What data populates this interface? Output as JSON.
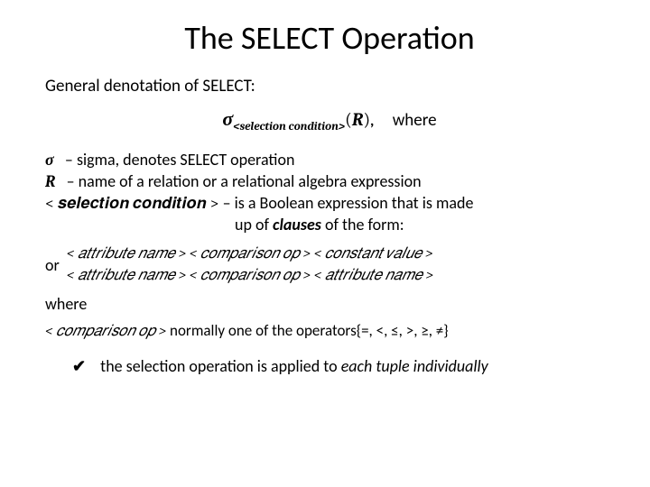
{
  "title": "The SELECT Operation",
  "subtitle": "General denotation of SELECT:",
  "formula": {
    "sigma": "σ",
    "subscript": "<selection condition>",
    "R_open": "(",
    "R": "R",
    "R_close": "),",
    "where": "where"
  },
  "defs": {
    "sigma_sym": "σ",
    "sigma_text": "– sigma, denotes SELECT operation",
    "R_sym": "R",
    "R_text": "– name of a relation or a relational algebra expression",
    "sc_sym": "< 𝒔𝒆𝒍𝒆𝒄𝒕𝒊𝒐𝒏 𝒄𝒐𝒏𝒅𝒊𝒕𝒊𝒐𝒏 >",
    "sc_text1": "– is a Boolean expression that is made",
    "sc_text2a": "up of ",
    "sc_text2b": "clauses",
    "sc_text2c": " of the form:"
  },
  "or_label": "or",
  "attr_line1": "< 𝑎𝑡𝑡𝑟𝑖𝑏𝑢𝑡𝑒 𝑛𝑎𝑚𝑒 > <  𝑐𝑜𝑚𝑝𝑎𝑟𝑖𝑠𝑜𝑛 𝑜𝑝 > < 𝑐𝑜𝑛𝑠𝑡𝑎𝑛𝑡 𝑣𝑎𝑙𝑢𝑒 >",
  "attr_line2": "< 𝑎𝑡𝑡𝑟𝑖𝑏𝑢𝑡𝑒 𝑛𝑎𝑚𝑒 > <  𝑐𝑜𝑚𝑝𝑎𝑟𝑖𝑠𝑜𝑛 𝑜𝑝 > < 𝑎𝑡𝑡𝑟𝑖𝑏𝑢𝑡𝑒 𝑛𝑎𝑚𝑒 >",
  "where_label": "where",
  "op_math": "<  𝑐𝑜𝑚𝑝𝑎𝑟𝑖𝑠𝑜𝑛 𝑜𝑝 >",
  "op_text": " normally one of the operators{=, <, ≤, >, ≥, ≠}",
  "check": "✔",
  "check_text_a": "the selection operation is applied to ",
  "check_text_b": "each tuple individually"
}
